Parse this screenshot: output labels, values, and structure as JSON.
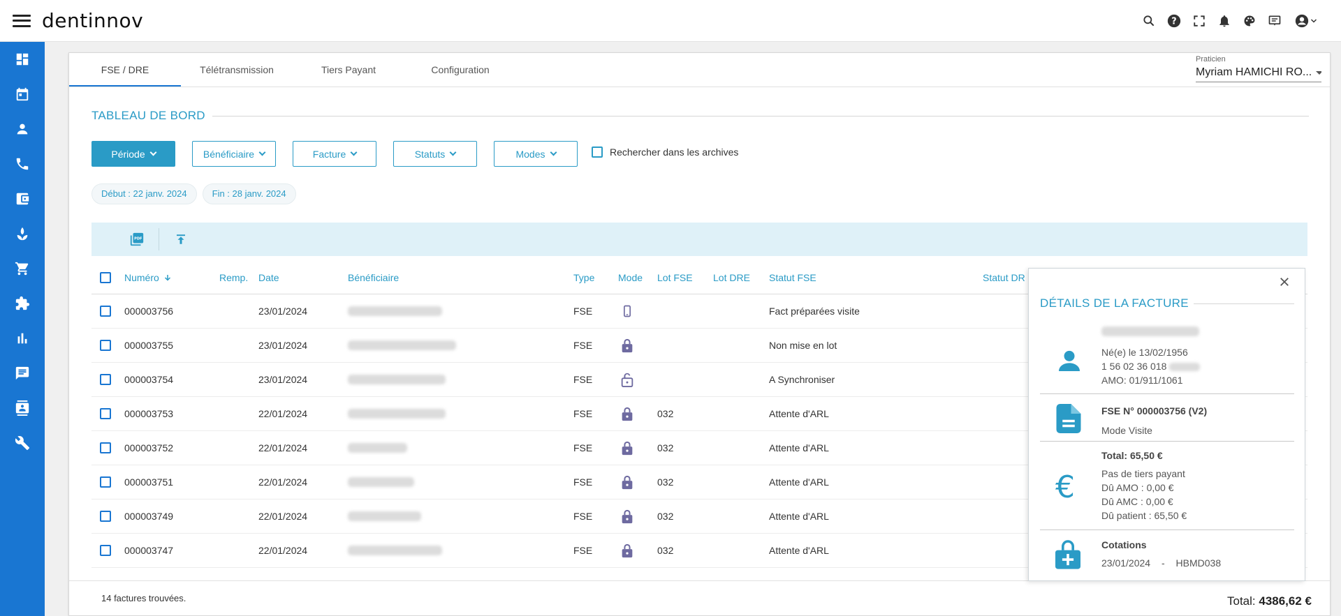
{
  "app": {
    "logo": "dentinnov"
  },
  "top_icons": [
    "search-icon",
    "help-icon",
    "fullscreen-icon",
    "bell-icon",
    "palette-icon",
    "message-board-icon",
    "account-icon",
    "chevron-down-icon"
  ],
  "sidebar": {
    "items": [
      {
        "icon": "dashboard-icon"
      },
      {
        "icon": "calendar-icon"
      },
      {
        "icon": "person-icon"
      },
      {
        "icon": "phone-icon"
      },
      {
        "icon": "wallet-icon"
      },
      {
        "icon": "spa-icon"
      },
      {
        "icon": "cart-icon"
      },
      {
        "icon": "puzzle-icon"
      },
      {
        "icon": "bar-chart-icon"
      },
      {
        "icon": "chat-icon"
      },
      {
        "icon": "contact-card-icon"
      },
      {
        "icon": "wrench-icon"
      }
    ]
  },
  "tabs": [
    {
      "label": "FSE / DRE",
      "active": true
    },
    {
      "label": "Télétransmission",
      "active": false
    },
    {
      "label": "Tiers Payant",
      "active": false
    },
    {
      "label": "Configuration",
      "active": false
    }
  ],
  "praticien": {
    "label": "Praticien",
    "value": "Myriam HAMICHI RO..."
  },
  "dashboard": {
    "title": "TABLEAU DE BORD"
  },
  "filters": {
    "periode": "Période",
    "beneficiaire": "Bénéficiaire",
    "facture": "Facture",
    "statuts": "Statuts",
    "modes": "Modes",
    "archives": "Rechercher dans les archives"
  },
  "chips": {
    "debut": "Début : 22 janv. 2024",
    "fin": "Fin : 28 janv. 2024"
  },
  "table": {
    "headers": {
      "numero": "Numéro",
      "remp": "Remp.",
      "date": "Date",
      "beneficiaire": "Bénéficiaire",
      "type": "Type",
      "mode": "Mode",
      "lot_fse": "Lot FSE",
      "lot_dre": "Lot DRE",
      "statut_fse": "Statut FSE",
      "statut_dre": "Statut DR"
    },
    "rows": [
      {
        "numero": "000003756",
        "date": "23/01/2024",
        "type": "FSE",
        "mode_icon": "mobile-icon",
        "lot_fse": "",
        "statut_fse": "Fact préparées visite"
      },
      {
        "numero": "000003755",
        "date": "23/01/2024",
        "type": "FSE",
        "mode_icon": "lock-icon",
        "lot_fse": "",
        "statut_fse": "Non mise en lot"
      },
      {
        "numero": "000003754",
        "date": "23/01/2024",
        "type": "FSE",
        "mode_icon": "lock-open-icon",
        "lot_fse": "",
        "statut_fse": "A Synchroniser"
      },
      {
        "numero": "000003753",
        "date": "22/01/2024",
        "type": "FSE",
        "mode_icon": "lock-icon",
        "lot_fse": "032",
        "statut_fse": "Attente d'ARL"
      },
      {
        "numero": "000003752",
        "date": "22/01/2024",
        "type": "FSE",
        "mode_icon": "lock-icon",
        "lot_fse": "032",
        "statut_fse": "Attente d'ARL"
      },
      {
        "numero": "000003751",
        "date": "22/01/2024",
        "type": "FSE",
        "mode_icon": "lock-icon",
        "lot_fse": "032",
        "statut_fse": "Attente d'ARL"
      },
      {
        "numero": "000003749",
        "date": "22/01/2024",
        "type": "FSE",
        "mode_icon": "lock-icon",
        "lot_fse": "032",
        "statut_fse": "Attente d'ARL"
      },
      {
        "numero": "000003747",
        "date": "22/01/2024",
        "type": "FSE",
        "mode_icon": "lock-icon",
        "lot_fse": "032",
        "statut_fse": "Attente d'ARL"
      }
    ]
  },
  "footer": {
    "count": "14 factures trouvées.",
    "total_label": "Total:",
    "total_value": "4386,62 €"
  },
  "details": {
    "title": "DÉTAILS DE LA FACTURE",
    "patient": {
      "born": "Né(e) le 13/02/1956",
      "ss": "1 56 02 36 018",
      "amo": "AMO: 01/911/1061"
    },
    "fse": {
      "title": "FSE N° 000003756 (V2)",
      "mode": "Mode Visite"
    },
    "amounts": {
      "total": "Total: 65,50 €",
      "tiers": "Pas de tiers payant",
      "amo": "Dû AMO : 0,00 €",
      "amc": "Dû AMC : 0,00 €",
      "patient": "Dû patient : 65,50 €"
    },
    "cotations": {
      "title": "Cotations",
      "date": "23/01/2024",
      "sep": "-",
      "code": "HBMD038"
    }
  },
  "colors": {
    "accent": "#2a9bc6",
    "sidebar": "#1976d2",
    "toolbar": "#dff1f8"
  }
}
